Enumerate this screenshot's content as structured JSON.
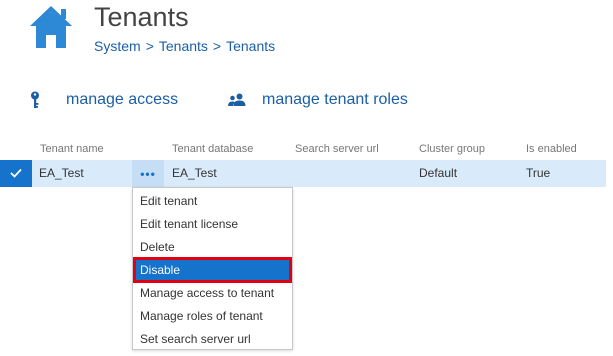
{
  "header": {
    "title": "Tenants",
    "breadcrumb": [
      "System",
      "Tenants",
      "Tenants"
    ],
    "breadcrumb_separator": ">"
  },
  "actions": {
    "manage_access": "manage access",
    "manage_tenant_roles": "manage tenant roles"
  },
  "table": {
    "columns": [
      "Tenant name",
      "Tenant database",
      "Search server url",
      "Cluster group",
      "Is enabled"
    ],
    "rows": [
      {
        "selected": true,
        "tenant_name": "EA_Test",
        "actions_glyph": "•••",
        "tenant_database": "EA_Test",
        "search_server_url": "",
        "cluster_group": "Default",
        "is_enabled": "True"
      }
    ]
  },
  "context_menu": {
    "items": [
      "Edit tenant",
      "Edit tenant license",
      "Delete",
      "Disable",
      "Manage access to tenant",
      "Manage roles of tenant",
      "Set search server url"
    ],
    "highlighted": "Disable"
  },
  "colors": {
    "accent": "#1573cc",
    "link": "#1a5fa6",
    "row_selected": "#d9ebfb",
    "highlight_border": "#e00012"
  },
  "icons": {
    "app": "house-icon",
    "manage_access": "key-icon",
    "manage_tenant_roles": "users-icon",
    "row_check": "check-icon"
  }
}
